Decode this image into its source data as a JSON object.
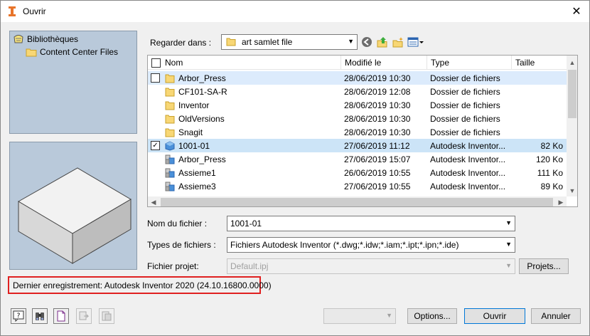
{
  "window": {
    "title": "Ouvrir"
  },
  "libraries": {
    "items": [
      {
        "label": "Bibliothèques",
        "icon": "library-icon"
      },
      {
        "label": "Content Center Files",
        "icon": "folder-icon"
      }
    ]
  },
  "lookin": {
    "label": "Regarder dans :",
    "value": "art samlet file"
  },
  "filelist": {
    "columns": [
      "Nom",
      "Modifié le",
      "Type",
      "Taille"
    ],
    "rows": [
      {
        "name": "Arbor_Press",
        "date": "28/06/2019 10:30",
        "type": "Dossier de fichiers",
        "size": "",
        "icon": "folder-icon"
      },
      {
        "name": "CF101-SA-R",
        "date": "28/06/2019 12:08",
        "type": "Dossier de fichiers",
        "size": "",
        "icon": "folder-icon"
      },
      {
        "name": "Inventor",
        "date": "28/06/2019 10:30",
        "type": "Dossier de fichiers",
        "size": "",
        "icon": "folder-icon"
      },
      {
        "name": "OldVersions",
        "date": "28/06/2019 10:30",
        "type": "Dossier de fichiers",
        "size": "",
        "icon": "folder-icon"
      },
      {
        "name": "Snagit",
        "date": "28/06/2019 10:30",
        "type": "Dossier de fichiers",
        "size": "",
        "icon": "folder-icon"
      },
      {
        "name": "1001-01",
        "date": "27/06/2019 11:12",
        "type": "Autodesk Inventor...",
        "size": "82 Ko",
        "icon": "part-icon"
      },
      {
        "name": "Arbor_Press",
        "date": "27/06/2019 15:07",
        "type": "Autodesk Inventor...",
        "size": "120 Ko",
        "icon": "assembly-icon"
      },
      {
        "name": "Assieme1",
        "date": "26/06/2019 10:55",
        "type": "Autodesk Inventor...",
        "size": "111 Ko",
        "icon": "assembly-icon"
      },
      {
        "name": "Assieme3",
        "date": "27/06/2019 10:55",
        "type": "Autodesk Inventor...",
        "size": "89 Ko",
        "icon": "assembly-icon"
      }
    ]
  },
  "form": {
    "filename_label": "Nom du fichier :",
    "filename_value": "1001-01",
    "filetypes_label": "Types de fichiers :",
    "filetypes_value": "Fichiers Autodesk Inventor (*.dwg;*.idw;*.iam;*.ipt;*.ipn;*.ide)",
    "project_label": "Fichier projet:",
    "project_value": "Default.ipj",
    "projects_button": "Projets..."
  },
  "last_save": "Dernier enregistrement: Autodesk Inventor 2020 (24.10.16800.0000)",
  "buttons": {
    "options": "Options...",
    "open": "Ouvrir",
    "cancel": "Annuler"
  }
}
